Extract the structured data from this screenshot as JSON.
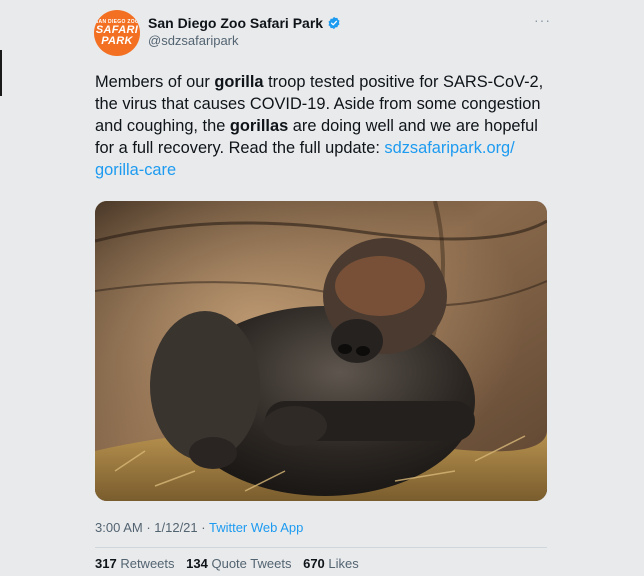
{
  "author": {
    "avatar_small": "SAN DIEGO ZOO",
    "avatar_line1": "SAFARI",
    "avatar_line2": "PARK",
    "name": "San Diego Zoo Safari Park",
    "handle": "@sdzsafaripark",
    "verified_icon": "verified-badge-icon",
    "verified_color": "#1d9bf0"
  },
  "more_label": "···",
  "tweet": {
    "t1": "Members of our ",
    "b1": "gorilla",
    "t2": " troop tested positive for SARS-CoV-2, the virus that causes COVID-19. Aside from some congestion and coughing, the ",
    "b2": "gorillas",
    "t3": " are doing well and we are hopeful for a full recovery. Read the full update: ",
    "link": "sdzsafaripark.org/ gorilla-care"
  },
  "meta": {
    "time": "3:00 AM",
    "sep1": " · ",
    "date": "1/12/21",
    "sep2": " · ",
    "source": "Twitter Web App"
  },
  "stats": {
    "retweets_count": "317",
    "retweets_label": "Retweets",
    "quotes_count": "134",
    "quotes_label": "Quote Tweets",
    "likes_count": "670",
    "likes_label": "Likes"
  },
  "colors": {
    "background": "#e9eaec",
    "text": "#0f1419",
    "muted": "#536471",
    "link": "#1d9bf0",
    "avatar": "#f36f21"
  }
}
